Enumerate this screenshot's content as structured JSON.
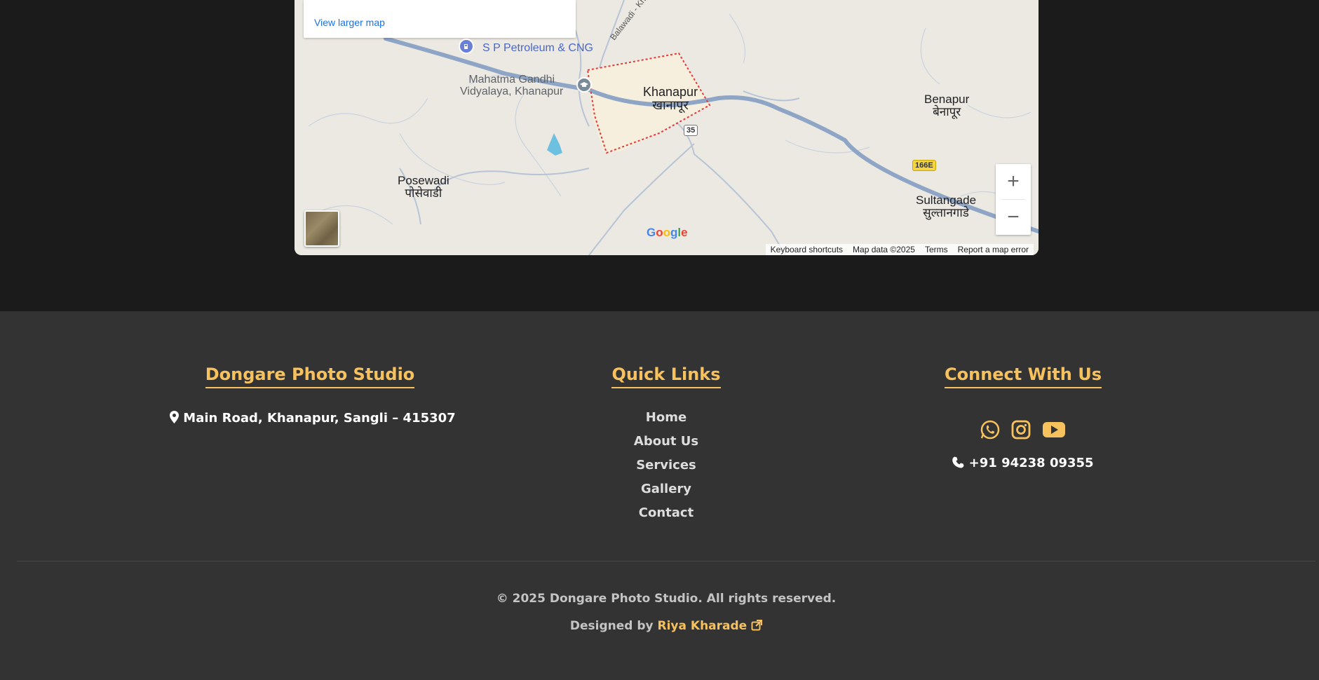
{
  "map": {
    "view_larger_label": "View larger map",
    "places": {
      "petroleum": "S P Petroleum & CNG",
      "vidyalaya_line1": "Mahatma Gandhi",
      "vidyalaya_line2": "Vidyalaya, Khanapur",
      "khanapur_en": "Khanapur",
      "khanapur_mr": "खानापूर",
      "benapur_en": "Benapur",
      "benapur_mr": "बेनापूर",
      "posewadi_en": "Posewadi",
      "posewadi_mr": "पोसेवाडी",
      "sultangade_en": "Sultangade",
      "sultangade_mr": "सुल्तानगाडे",
      "road_name": "Balawadi - Khanapur Rd"
    },
    "shields": {
      "route_35": "35",
      "route_166e": "166E"
    },
    "zoom_in": "+",
    "zoom_out": "−",
    "google_logo": "Google",
    "attribution": {
      "keyboard": "Keyboard shortcuts",
      "map_data": "Map data ©2025",
      "terms": "Terms",
      "report": "Report a map error"
    },
    "colors": {
      "land": "#ece9e2",
      "highway": "#8ea5c6",
      "boundary": "#e53935",
      "water": "#6ec0e0"
    }
  },
  "footer": {
    "brand": {
      "title": "Dongare Photo Studio",
      "address": "Main Road, Khanapur, Sangli – 415307"
    },
    "quick_links": {
      "title": "Quick Links",
      "items": [
        "Home",
        "About Us",
        "Services",
        "Gallery",
        "Contact"
      ]
    },
    "connect": {
      "title": "Connect With Us",
      "social": [
        "whatsapp-icon",
        "instagram-icon",
        "youtube-icon"
      ],
      "phone": "+91 94238 09355"
    },
    "copyright": "© 2025 Dongare Photo Studio. All rights reserved.",
    "designed_by_prefix": "Designed by",
    "designer": "Riya Kharade",
    "colors": {
      "accent": "#f7c25d",
      "bg": "#333333"
    }
  }
}
